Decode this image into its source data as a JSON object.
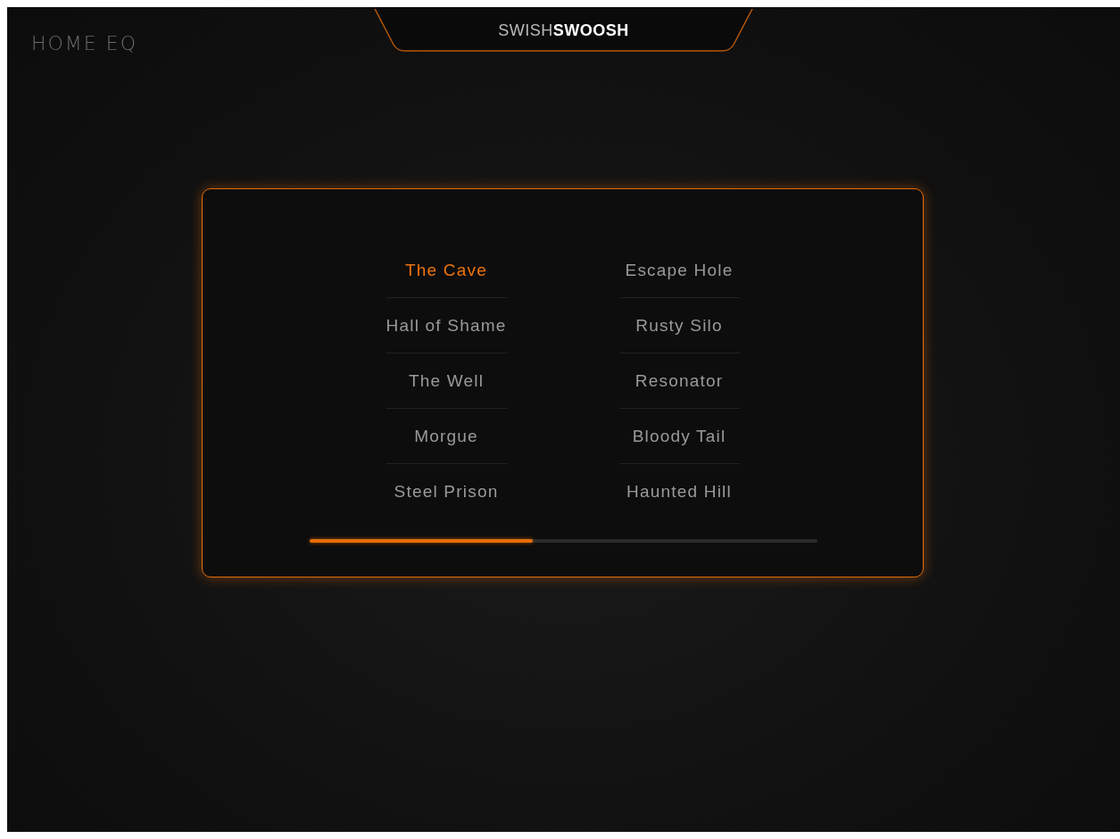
{
  "app": {
    "title": "HOME EQ",
    "logo": "SWISH**SWOOSH**"
  },
  "presets": {
    "columns": [
      [
        {
          "label": "The Cave",
          "selected": true
        },
        {
          "label": "Hall of Shame",
          "selected": false
        },
        {
          "label": "The Well",
          "selected": false
        },
        {
          "label": "Morgue",
          "selected": false
        },
        {
          "label": "Steel Prison",
          "selected": false
        }
      ],
      [
        {
          "label": "Escape Hole",
          "selected": false
        },
        {
          "label": "Rusty Silo",
          "selected": false
        },
        {
          "label": "Resonator",
          "selected": false
        },
        {
          "label": "Bloody Tail",
          "selected": false
        },
        {
          "label": "Haunted Hill",
          "selected": false
        }
      ]
    ]
  }
}
